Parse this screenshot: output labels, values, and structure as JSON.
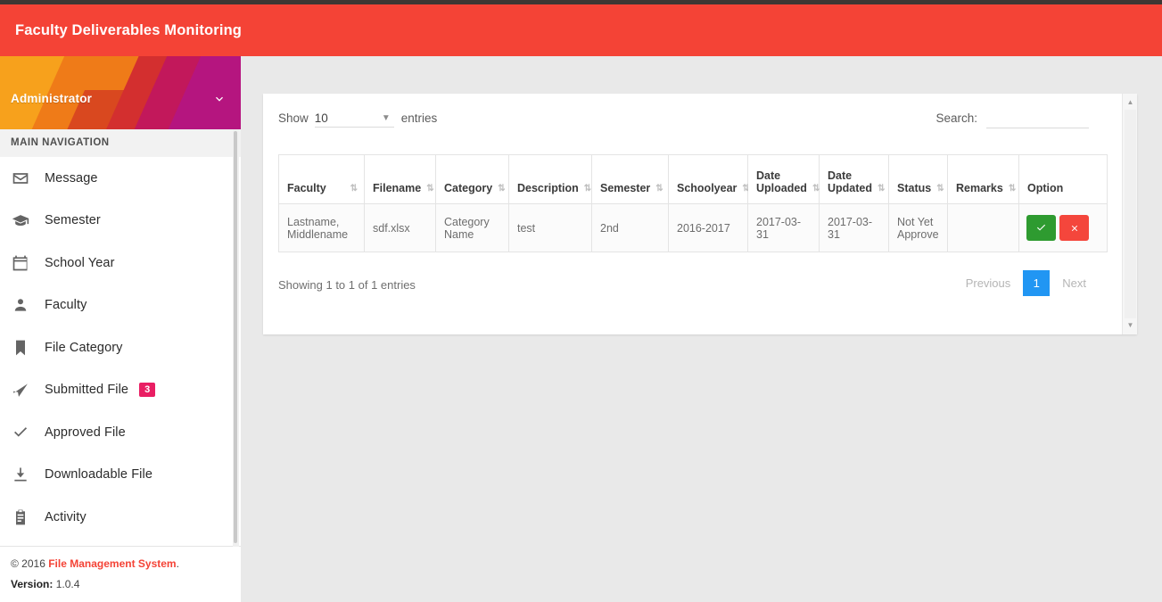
{
  "header": {
    "title": "Faculty Deliverables Monitoring",
    "accent_color": "#f44336",
    "top_strip_color": "#3d3733"
  },
  "sidebar": {
    "user": {
      "name": "Administrator",
      "caret_icon": "chevron-down-icon"
    },
    "nav_header": "MAIN NAVIGATION",
    "items": [
      {
        "label": "Message",
        "icon": "envelope-icon",
        "badge": null
      },
      {
        "label": "Semester",
        "icon": "graduation-cap-icon",
        "badge": null
      },
      {
        "label": "School Year",
        "icon": "calendar-check-icon",
        "badge": null
      },
      {
        "label": "Faculty",
        "icon": "person-icon",
        "badge": null
      },
      {
        "label": "File Category",
        "icon": "bookmark-icon",
        "badge": null
      },
      {
        "label": "Submitted File",
        "icon": "send-icon",
        "badge": "3"
      },
      {
        "label": "Approved File",
        "icon": "check-icon",
        "badge": null
      },
      {
        "label": "Downloadable File",
        "icon": "download-icon",
        "badge": null
      },
      {
        "label": "Activity",
        "icon": "clipboard-icon",
        "badge": null
      }
    ],
    "badge_color": "#e91e63",
    "footer": {
      "copyright_prefix": "© 2016 ",
      "brand": "File Management System",
      "copyright_suffix": ".",
      "version_label": "Version:",
      "version_value": "1.0.4"
    }
  },
  "table_panel": {
    "length": {
      "show_label": "Show",
      "value": "10",
      "entries_label": "entries",
      "caret_icon": "caret-down-icon"
    },
    "search": {
      "label": "Search:",
      "value": "",
      "placeholder": ""
    },
    "columns": [
      {
        "label": "Faculty",
        "sortable": true
      },
      {
        "label": "Filename",
        "sortable": true
      },
      {
        "label": "Category",
        "sortable": true
      },
      {
        "label": "Description",
        "sortable": true
      },
      {
        "label": "Semester",
        "sortable": true
      },
      {
        "label": "Schoolyear",
        "sortable": true
      },
      {
        "label": "Date Uploaded",
        "sortable": true
      },
      {
        "label": "Date Updated",
        "sortable": true
      },
      {
        "label": "Status",
        "sortable": true
      },
      {
        "label": "Remarks",
        "sortable": true
      },
      {
        "label": "Option",
        "sortable": false
      }
    ],
    "sort_icon": "sort-updown-icon",
    "rows": [
      {
        "faculty": "Lastname, Middlename",
        "filename": "sdf.xlsx",
        "category": "Category Name",
        "description": "test",
        "semester": "2nd",
        "schoolyear": "2016-2017",
        "date_uploaded": "2017-03-31",
        "date_updated": "2017-03-31",
        "status": "Not Yet Approve",
        "remarks": "",
        "approve_icon": "check-icon",
        "reject_icon": "close-icon"
      }
    ],
    "info": "Showing 1 to 1 of 1 entries",
    "pagination": {
      "previous": "Previous",
      "current_page": "1",
      "next": "Next",
      "active_color": "#2196f3"
    },
    "scrollbar": {
      "up_icon": "triangle-up-icon",
      "down_icon": "triangle-down-icon"
    }
  }
}
